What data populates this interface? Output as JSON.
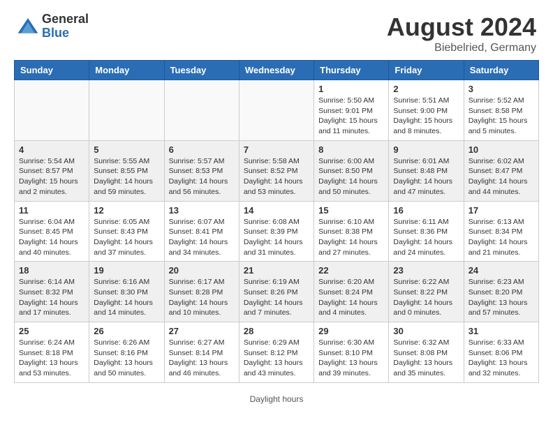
{
  "header": {
    "logo_general": "General",
    "logo_blue": "Blue",
    "title": "August 2024",
    "location": "Biebelried, Germany"
  },
  "calendar": {
    "days_of_week": [
      "Sunday",
      "Monday",
      "Tuesday",
      "Wednesday",
      "Thursday",
      "Friday",
      "Saturday"
    ],
    "footer": "Daylight hours",
    "weeks": [
      [
        {
          "day": "",
          "info": ""
        },
        {
          "day": "",
          "info": ""
        },
        {
          "day": "",
          "info": ""
        },
        {
          "day": "",
          "info": ""
        },
        {
          "day": "1",
          "info": "Sunrise: 5:50 AM\nSunset: 9:01 PM\nDaylight: 15 hours\nand 11 minutes."
        },
        {
          "day": "2",
          "info": "Sunrise: 5:51 AM\nSunset: 9:00 PM\nDaylight: 15 hours\nand 8 minutes."
        },
        {
          "day": "3",
          "info": "Sunrise: 5:52 AM\nSunset: 8:58 PM\nDaylight: 15 hours\nand 5 minutes."
        }
      ],
      [
        {
          "day": "4",
          "info": "Sunrise: 5:54 AM\nSunset: 8:57 PM\nDaylight: 15 hours\nand 2 minutes."
        },
        {
          "day": "5",
          "info": "Sunrise: 5:55 AM\nSunset: 8:55 PM\nDaylight: 14 hours\nand 59 minutes."
        },
        {
          "day": "6",
          "info": "Sunrise: 5:57 AM\nSunset: 8:53 PM\nDaylight: 14 hours\nand 56 minutes."
        },
        {
          "day": "7",
          "info": "Sunrise: 5:58 AM\nSunset: 8:52 PM\nDaylight: 14 hours\nand 53 minutes."
        },
        {
          "day": "8",
          "info": "Sunrise: 6:00 AM\nSunset: 8:50 PM\nDaylight: 14 hours\nand 50 minutes."
        },
        {
          "day": "9",
          "info": "Sunrise: 6:01 AM\nSunset: 8:48 PM\nDaylight: 14 hours\nand 47 minutes."
        },
        {
          "day": "10",
          "info": "Sunrise: 6:02 AM\nSunset: 8:47 PM\nDaylight: 14 hours\nand 44 minutes."
        }
      ],
      [
        {
          "day": "11",
          "info": "Sunrise: 6:04 AM\nSunset: 8:45 PM\nDaylight: 14 hours\nand 40 minutes."
        },
        {
          "day": "12",
          "info": "Sunrise: 6:05 AM\nSunset: 8:43 PM\nDaylight: 14 hours\nand 37 minutes."
        },
        {
          "day": "13",
          "info": "Sunrise: 6:07 AM\nSunset: 8:41 PM\nDaylight: 14 hours\nand 34 minutes."
        },
        {
          "day": "14",
          "info": "Sunrise: 6:08 AM\nSunset: 8:39 PM\nDaylight: 14 hours\nand 31 minutes."
        },
        {
          "day": "15",
          "info": "Sunrise: 6:10 AM\nSunset: 8:38 PM\nDaylight: 14 hours\nand 27 minutes."
        },
        {
          "day": "16",
          "info": "Sunrise: 6:11 AM\nSunset: 8:36 PM\nDaylight: 14 hours\nand 24 minutes."
        },
        {
          "day": "17",
          "info": "Sunrise: 6:13 AM\nSunset: 8:34 PM\nDaylight: 14 hours\nand 21 minutes."
        }
      ],
      [
        {
          "day": "18",
          "info": "Sunrise: 6:14 AM\nSunset: 8:32 PM\nDaylight: 14 hours\nand 17 minutes."
        },
        {
          "day": "19",
          "info": "Sunrise: 6:16 AM\nSunset: 8:30 PM\nDaylight: 14 hours\nand 14 minutes."
        },
        {
          "day": "20",
          "info": "Sunrise: 6:17 AM\nSunset: 8:28 PM\nDaylight: 14 hours\nand 10 minutes."
        },
        {
          "day": "21",
          "info": "Sunrise: 6:19 AM\nSunset: 8:26 PM\nDaylight: 14 hours\nand 7 minutes."
        },
        {
          "day": "22",
          "info": "Sunrise: 6:20 AM\nSunset: 8:24 PM\nDaylight: 14 hours\nand 4 minutes."
        },
        {
          "day": "23",
          "info": "Sunrise: 6:22 AM\nSunset: 8:22 PM\nDaylight: 14 hours\nand 0 minutes."
        },
        {
          "day": "24",
          "info": "Sunrise: 6:23 AM\nSunset: 8:20 PM\nDaylight: 13 hours\nand 57 minutes."
        }
      ],
      [
        {
          "day": "25",
          "info": "Sunrise: 6:24 AM\nSunset: 8:18 PM\nDaylight: 13 hours\nand 53 minutes."
        },
        {
          "day": "26",
          "info": "Sunrise: 6:26 AM\nSunset: 8:16 PM\nDaylight: 13 hours\nand 50 minutes."
        },
        {
          "day": "27",
          "info": "Sunrise: 6:27 AM\nSunset: 8:14 PM\nDaylight: 13 hours\nand 46 minutes."
        },
        {
          "day": "28",
          "info": "Sunrise: 6:29 AM\nSunset: 8:12 PM\nDaylight: 13 hours\nand 43 minutes."
        },
        {
          "day": "29",
          "info": "Sunrise: 6:30 AM\nSunset: 8:10 PM\nDaylight: 13 hours\nand 39 minutes."
        },
        {
          "day": "30",
          "info": "Sunrise: 6:32 AM\nSunset: 8:08 PM\nDaylight: 13 hours\nand 35 minutes."
        },
        {
          "day": "31",
          "info": "Sunrise: 6:33 AM\nSunset: 8:06 PM\nDaylight: 13 hours\nand 32 minutes."
        }
      ]
    ]
  }
}
